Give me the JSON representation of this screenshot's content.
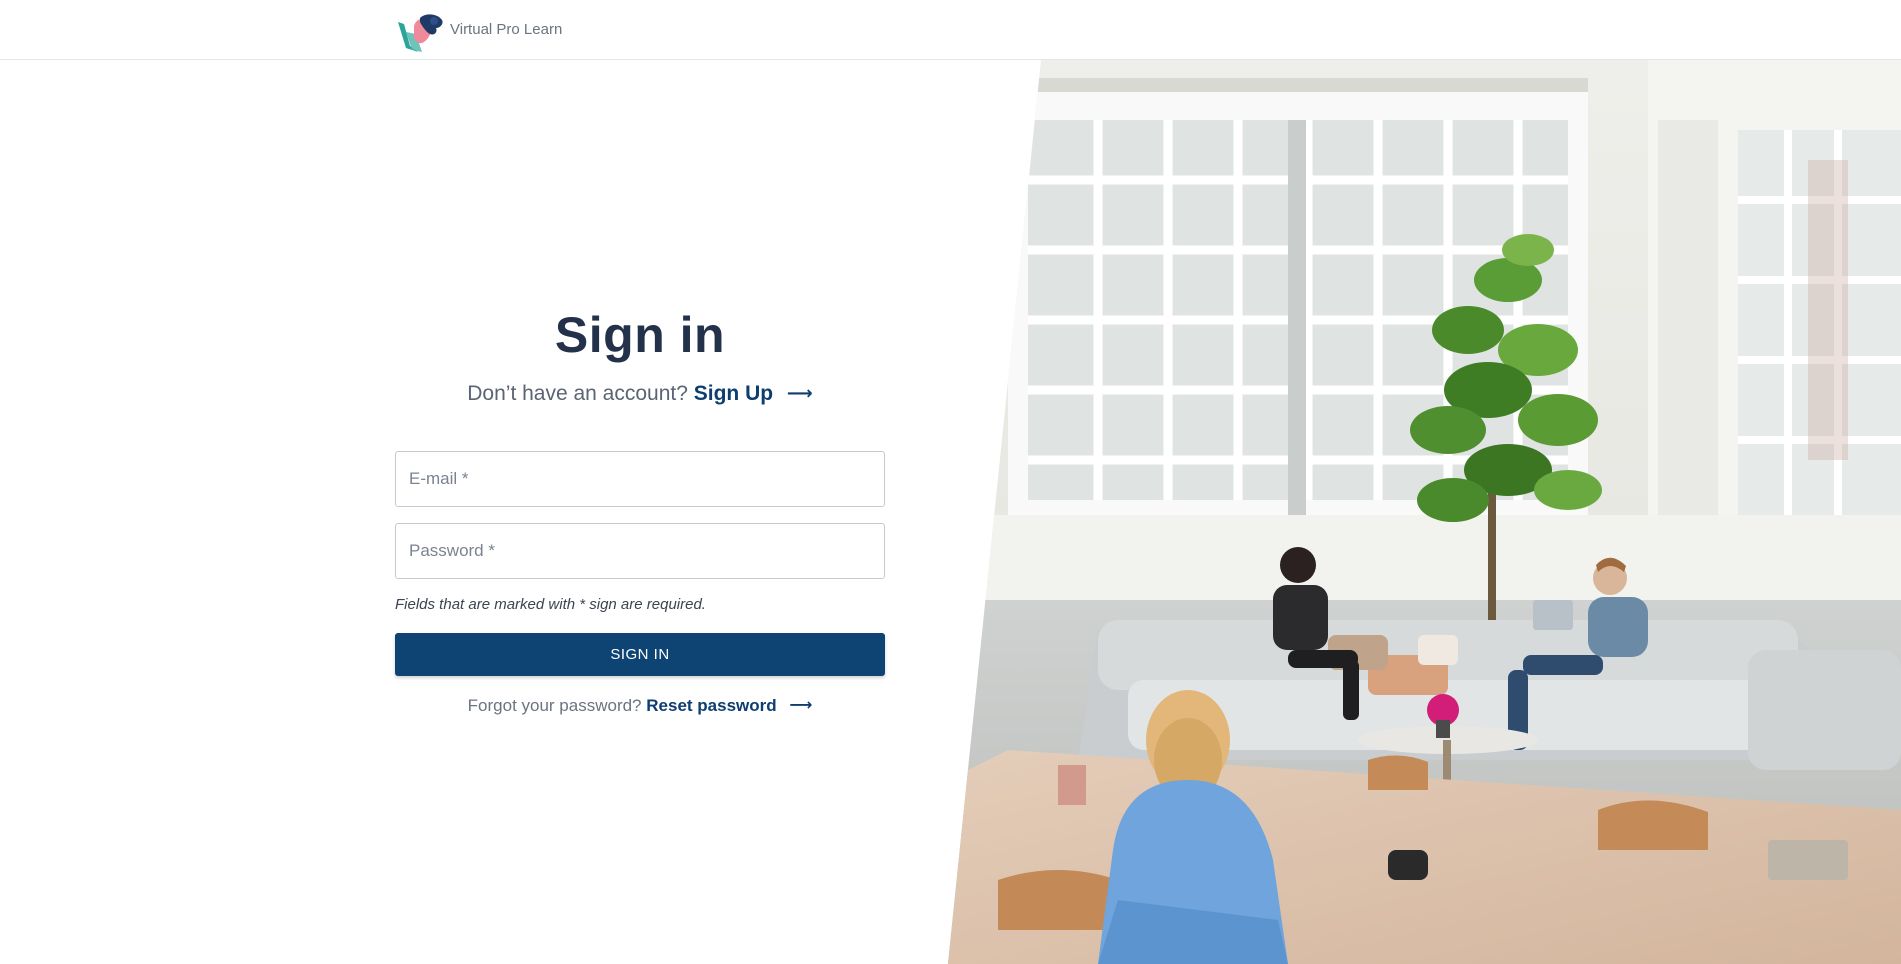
{
  "header": {
    "brand_name": "Virtual Pro Learn",
    "logo_icon": "virtual-pro-learn-logo"
  },
  "signin": {
    "title": "Sign in",
    "no_account_text": "Don’t have an account?",
    "signup_link": "Sign Up",
    "arrow": "⟶",
    "email_placeholder": "E-mail *",
    "password_placeholder": "Password *",
    "required_note": "Fields that are marked with * sign are required.",
    "signin_button": "SIGN IN",
    "forgot_text": "Forgot your password?",
    "reset_link": "Reset password"
  },
  "colors": {
    "primary": "#0d4473",
    "title": "#24314a",
    "link": "#0e3e6f",
    "muted": "#6b7480"
  },
  "hero": {
    "image_subject": "office-lounge-photo"
  }
}
